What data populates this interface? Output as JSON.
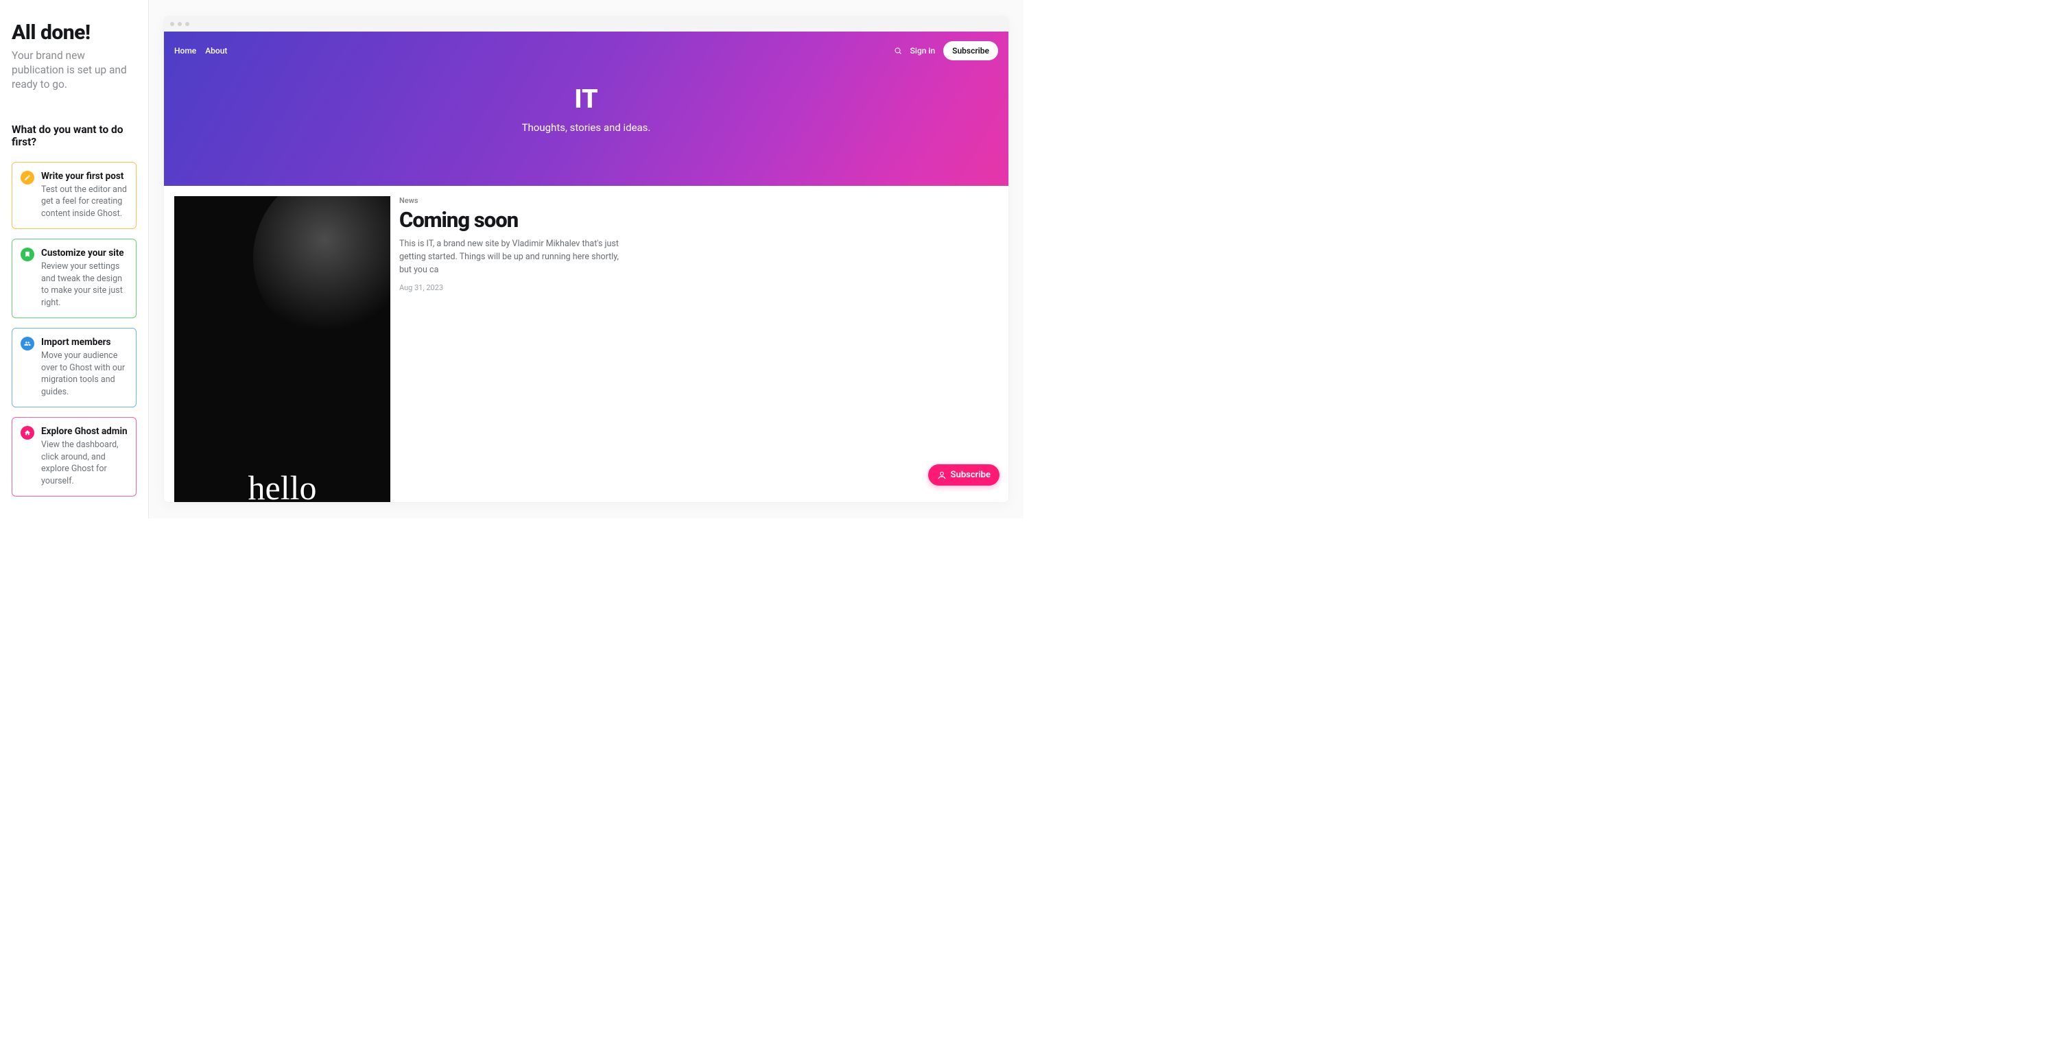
{
  "sidebar": {
    "headline": "All done!",
    "subhead": "Your brand new publication is set up and ready to go.",
    "question": "What do you want to do first?",
    "cards": [
      {
        "icon": "edit-icon",
        "title": "Write your first post",
        "desc": "Test out the editor and get a feel for creating content inside Ghost."
      },
      {
        "icon": "palette-icon",
        "title": "Customize your site",
        "desc": "Review your settings and tweak the design to make your site just right."
      },
      {
        "icon": "users-icon",
        "title": "Import members",
        "desc": "Move your audience over to Ghost with our migration tools and guides."
      },
      {
        "icon": "home-icon",
        "title": "Explore Ghost admin",
        "desc": "View the dashboard, click around, and explore Ghost for yourself."
      }
    ]
  },
  "preview": {
    "nav": {
      "home": "Home",
      "about": "About",
      "signin": "Sign in",
      "subscribe": "Subscribe"
    },
    "hero": {
      "title": "IT",
      "tagline": "Thoughts, stories and ideas."
    },
    "post": {
      "tag": "News",
      "title": "Coming soon",
      "excerpt": "This is IT, a brand new site by Vladimir Mikhalev that's just getting started. Things will be up and running here shortly, but you ca",
      "date": "Aug 31, 2023",
      "image_text": "hello"
    },
    "fab": {
      "label": "Subscribe"
    }
  }
}
